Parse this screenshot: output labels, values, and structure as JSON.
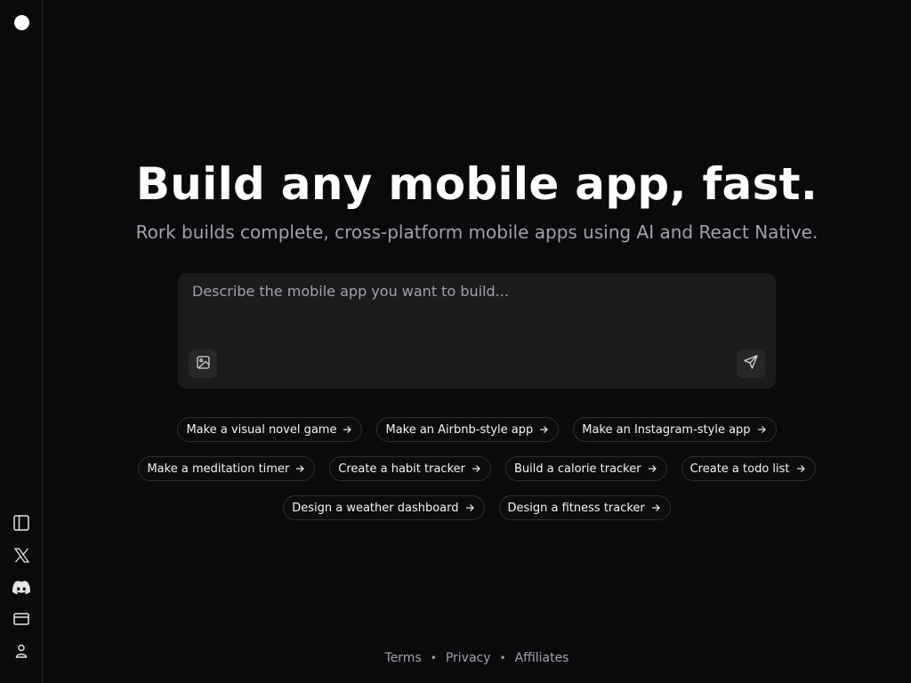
{
  "hero": {
    "title": "Build any mobile app, fast.",
    "subtitle": "Rork builds complete, cross-platform mobile apps using AI and React Native."
  },
  "prompt": {
    "placeholder": "Describe the mobile app you want to build...",
    "value": ""
  },
  "suggestions": {
    "row1": [
      "Make a visual novel game",
      "Make an Airbnb-style app",
      "Make an Instagram-style app"
    ],
    "row2": [
      "Make a meditation timer",
      "Create a habit tracker",
      "Build a calorie tracker",
      "Create a todo list"
    ],
    "row3": [
      "Design a weather dashboard",
      "Design a fitness tracker"
    ]
  },
  "footer": {
    "links": [
      "Terms",
      "Privacy",
      "Affiliates"
    ],
    "separator": "•"
  },
  "sidebar": {
    "icons": [
      "panel-toggle-icon",
      "x-twitter-icon",
      "discord-icon",
      "credit-card-icon",
      "user-icon"
    ]
  },
  "colors": {
    "background": "#0a0a0c",
    "panel": "#1b1b1e",
    "border": "#27272a",
    "text": "#ffffff",
    "muted": "#a1a1aa"
  }
}
